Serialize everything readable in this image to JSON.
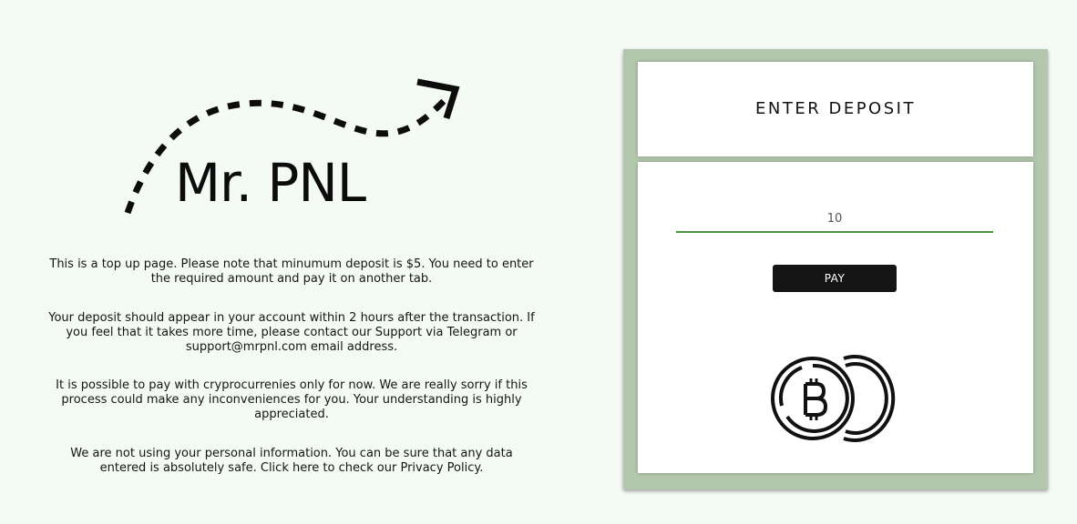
{
  "brand": {
    "logo_text": "Mr. PNL"
  },
  "info": {
    "paragraph_1": "This is a top up page. Please note that minumum deposit is $5. You need to enter the required amount and pay it on another tab.",
    "paragraph_2": "Your deposit should appear in your account within 2 hours after the transaction. If you feel that it takes more time, please contact our Support via Telegram or support@mrpnl.com email address.",
    "paragraph_3": "It is possible to pay with cryprocurrenies only for now. We are really sorry if this process could make any inconveniences for you. Your understanding is highly appreciated.",
    "paragraph_4": "We are not using your personal information. You can be sure that any data entered is absolutely safe. Click here to check our Privacy Policy."
  },
  "deposit_card": {
    "title": "ENTER DEPOSIT",
    "amount_value": "10",
    "pay_label": "PAY",
    "coin_icon": "bitcoin-coins-icon"
  },
  "colors": {
    "page_background": "#f4faf4",
    "card_frame": "#b3c7ad",
    "input_underline": "#4a9440",
    "button_background": "#141414"
  }
}
